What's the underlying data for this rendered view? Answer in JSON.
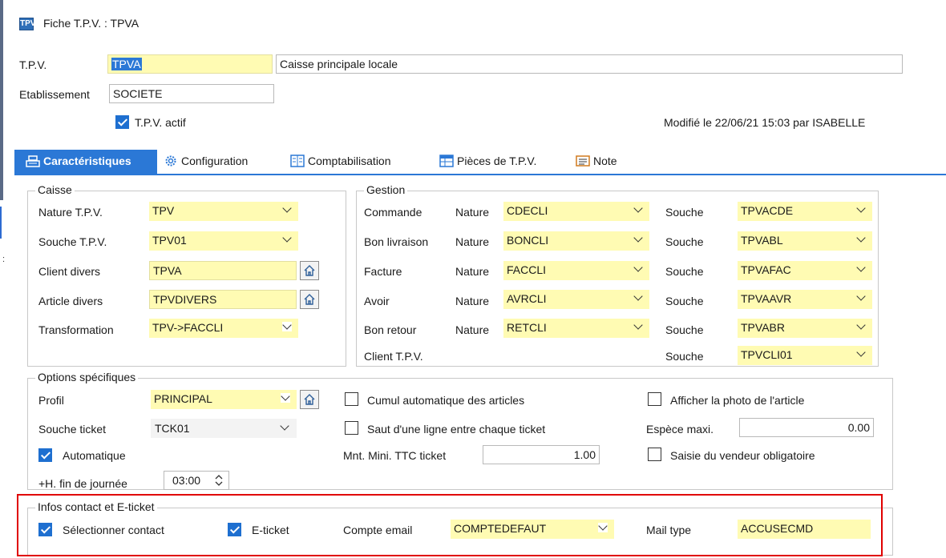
{
  "window": {
    "title": "Fiche T.P.V. : TPVA",
    "title_icon": "TPV"
  },
  "header": {
    "tpv_label": "T.P.V.",
    "tpv_code": "TPVA",
    "tpv_description": "Caisse principale locale",
    "etablissement_label": "Etablissement",
    "etablissement_value": "SOCIETE",
    "actif_label": "T.P.V. actif",
    "actif_checked": true,
    "modified_text": "Modifié le 22/06/21 15:03 par ISABELLE"
  },
  "tabs": [
    {
      "label": "Caractéristiques",
      "icon": "register-icon",
      "active": true
    },
    {
      "label": "Configuration",
      "icon": "gear-icon"
    },
    {
      "label": "Comptabilisation",
      "icon": "ledger-icon"
    },
    {
      "label": "Pièces de T.P.V.",
      "icon": "table-icon"
    },
    {
      "label": "Note",
      "icon": "note-icon"
    }
  ],
  "caisse": {
    "legend": "Caisse",
    "nature_label": "Nature T.P.V.",
    "nature_value": "TPV",
    "souche_label": "Souche T.P.V.",
    "souche_value": "TPV01",
    "client_label": "Client divers",
    "client_value": "TPVA",
    "article_label": "Article divers",
    "article_value": "TPVDIVERS",
    "transfo_label": "Transformation",
    "transfo_value": "TPV->FACCLI"
  },
  "gestion": {
    "legend": "Gestion",
    "nature_word": "Nature",
    "souche_word": "Souche",
    "rows": [
      {
        "label": "Commande",
        "nature": "CDECLI",
        "souche": "TPVACDE"
      },
      {
        "label": "Bon livraison",
        "nature": "BONCLI",
        "souche": "TPVABL"
      },
      {
        "label": "Facture",
        "nature": "FACCLI",
        "souche": "TPVAFAC"
      },
      {
        "label": "Avoir",
        "nature": "AVRCLI",
        "souche": "TPVAAVR"
      },
      {
        "label": "Bon retour",
        "nature": "RETCLI",
        "souche": "TPVABR"
      }
    ],
    "client_tpv_label": "Client T.P.V.",
    "client_tpv_souche": "TPVCLI01"
  },
  "options": {
    "legend": "Options spécifiques",
    "profil_label": "Profil",
    "profil_value": "PRINCIPAL",
    "souche_ticket_label": "Souche ticket",
    "souche_ticket_value": "TCK01",
    "automatique_label": "Automatique",
    "automatique_checked": true,
    "fin_journee_label": "+H. fin de journée",
    "fin_journee_value": "03:00",
    "cumul_label": "Cumul automatique des articles",
    "cumul_checked": false,
    "saut_label": "Saut d'une ligne entre chaque ticket",
    "saut_checked": false,
    "mnt_label": "Mnt. Mini. TTC ticket",
    "mnt_value": "1.00",
    "photo_label": "Afficher la photo de l'article",
    "photo_checked": false,
    "espece_label": "Espèce maxi.",
    "espece_value": "0.00",
    "vendeur_label": "Saisie du vendeur obligatoire",
    "vendeur_checked": false
  },
  "contact": {
    "legend": "Infos contact et E-ticket",
    "select_contact_label": "Sélectionner contact",
    "select_contact_checked": true,
    "eticket_label": "E-ticket",
    "eticket_checked": true,
    "compte_label": "Compte email",
    "compte_value": "COMPTEDEFAUT",
    "mail_label": "Mail type",
    "mail_value": "ACCUSECMD"
  },
  "colors": {
    "accent": "#2b78d6",
    "field_yellow": "#fffbb3",
    "highlight": "#e00000"
  }
}
